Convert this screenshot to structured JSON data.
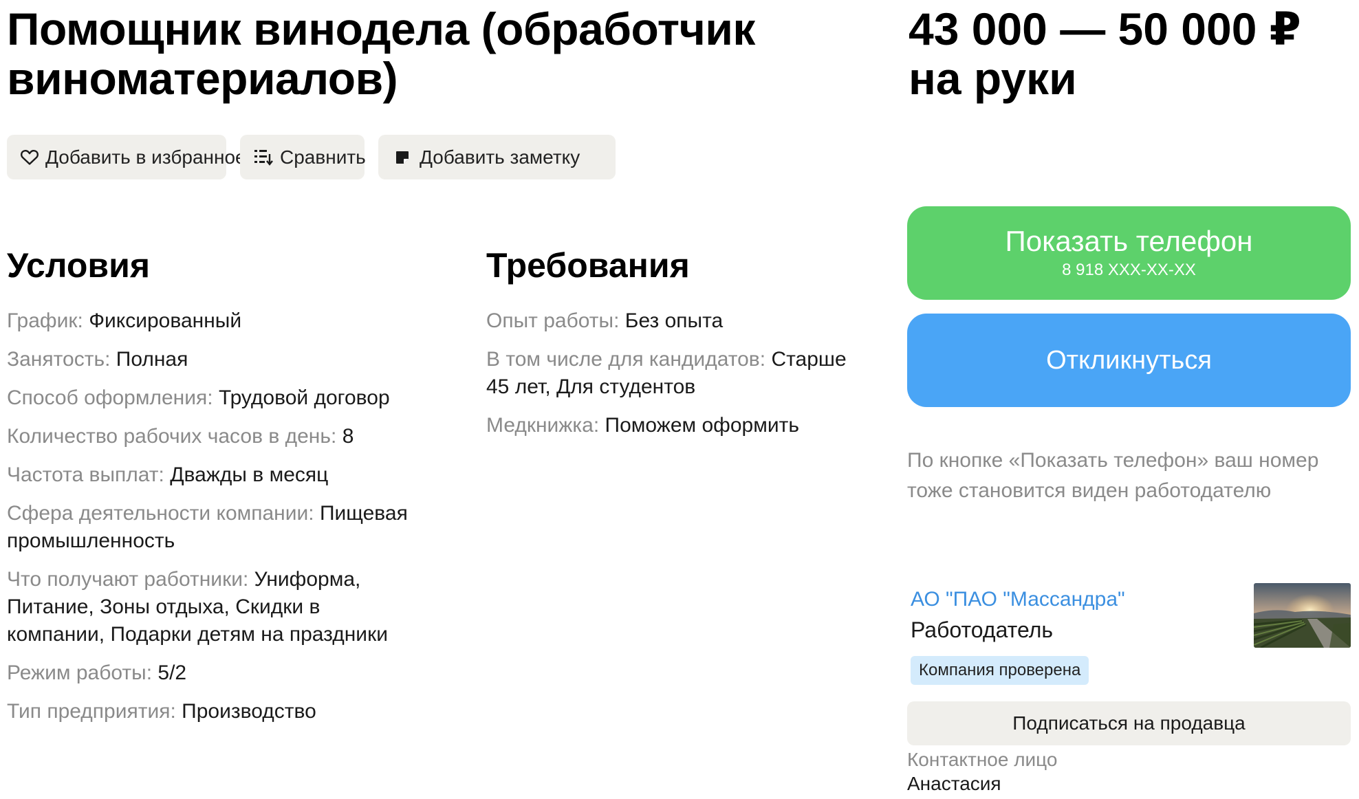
{
  "vacancy": {
    "title": "Помощник винодела (обработчик виноматериалов)",
    "salary_range": "43 000 — 50 000 ₽",
    "salary_note": "на руки"
  },
  "actions": {
    "favorite": {
      "label": "Добавить в избранное",
      "icon": "heart-icon"
    },
    "compare": {
      "label": "Сравнить",
      "icon": "compare-icon"
    },
    "note": {
      "label": "Добавить заметку",
      "icon": "note-icon"
    }
  },
  "conditions": {
    "heading": "Условия",
    "items": [
      {
        "label": "График:",
        "value": "Фиксированный"
      },
      {
        "label": "Занятость:",
        "value": "Полная"
      },
      {
        "label": "Способ оформления:",
        "value": "Трудовой договор"
      },
      {
        "label": "Количество рабочих часов в день:",
        "value": "8"
      },
      {
        "label": "Частота выплат:",
        "value": "Дважды в месяц"
      },
      {
        "label": "Сфера деятельности компании:",
        "value": "Пищевая промышленность"
      },
      {
        "label": "Что получают работники:",
        "value": "Униформа, Питание, Зоны отдыха, Скидки в компании, Подарки детям на праздники"
      },
      {
        "label": "Режим работы:",
        "value": "5/2"
      },
      {
        "label": "Тип предприятия:",
        "value": "Производство"
      }
    ]
  },
  "requirements": {
    "heading": "Требования",
    "items": [
      {
        "label": "Опыт работы:",
        "value": "Без опыта"
      },
      {
        "label": "В том числе для кандидатов:",
        "value": "Старше 45 лет, Для студентов"
      },
      {
        "label": "Медкнижка:",
        "value": "Поможем оформить"
      }
    ]
  },
  "contact_panel": {
    "show_phone_label": "Показать телефон",
    "phone_masked": "8 918 XXX-XX-XX",
    "respond_label": "Откликнуться",
    "phone_note": "По кнопке «Показать телефон» ваш номер тоже становится виден работодателю",
    "company_name": "АО \"ПАО \"Массандра\"",
    "company_role": "Работодатель",
    "verified_badge": "Компания проверена",
    "subscribe_label": "Подписаться на продавца",
    "contact_person_label": "Контактное лицо",
    "contact_person_name": "Анастасия"
  },
  "colors": {
    "phone_button": "#5dd16b",
    "respond_button": "#4aa5f6",
    "company_link": "#3b8fe0",
    "verified_badge_bg": "#d4ebfc",
    "secondary_button_bg": "#f0efeb"
  }
}
